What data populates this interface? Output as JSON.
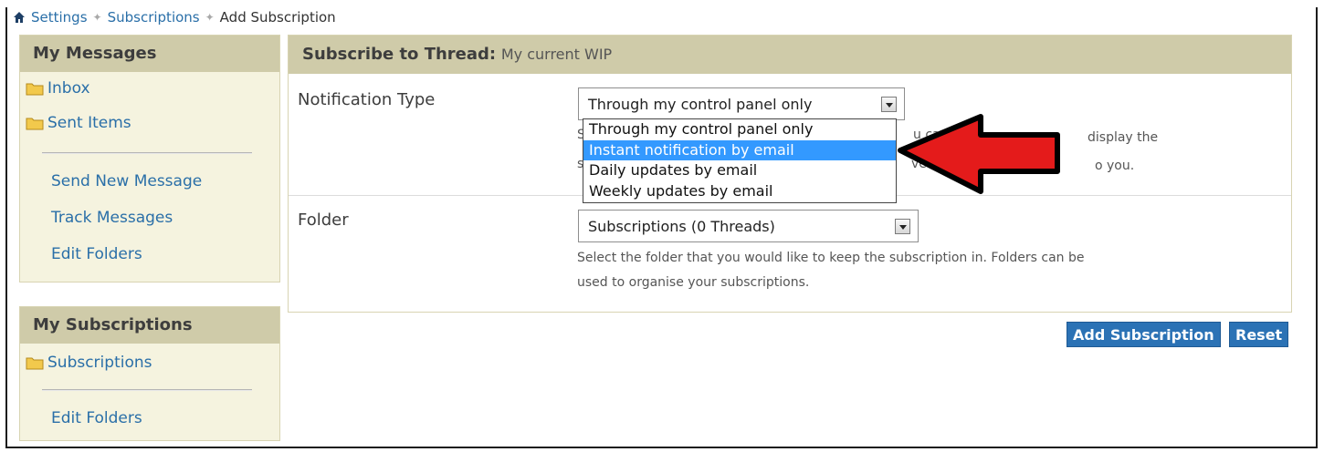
{
  "breadcrumb": {
    "items": [
      "Settings",
      "Subscriptions"
    ],
    "current": "Add Subscription"
  },
  "sidebar": {
    "messages": {
      "title": "My Messages",
      "folders": [
        "Inbox",
        "Sent Items"
      ],
      "links": [
        "Send New Message",
        "Track Messages",
        "Edit Folders"
      ]
    },
    "subscriptions": {
      "title": "My Subscriptions",
      "folders": [
        "Subscriptions"
      ],
      "links": [
        "Edit Folders"
      ]
    }
  },
  "main": {
    "header_bold": "Subscribe to Thread",
    "header_sep": ":",
    "thread_name": "My current WIP",
    "notification": {
      "label": "Notification Type",
      "selected": "Through my control panel only",
      "options": [
        "Through my control panel only",
        "Instant notification by email",
        "Daily updates by email",
        "Weekly updates by email"
      ],
      "highlighted_index": 1,
      "help_fragments": [
        "S",
        "u ca",
        "display the",
        "s",
        "ve",
        "o you."
      ]
    },
    "folder": {
      "label": "Folder",
      "selected": "Subscriptions (0 Threads)",
      "help_line1": "Select the folder that you would like to keep the subscription in. Folders can be",
      "help_line2": "used to organise your subscriptions."
    },
    "buttons": {
      "add": "Add Subscription",
      "reset": "Reset"
    }
  },
  "colors": {
    "header_bg": "#cfcba9",
    "sidebar_bg": "#f5f3df",
    "link": "#2a6fa8",
    "button": "#2b72b5",
    "highlight": "#3399ff",
    "arrow": "#e41b1b"
  }
}
